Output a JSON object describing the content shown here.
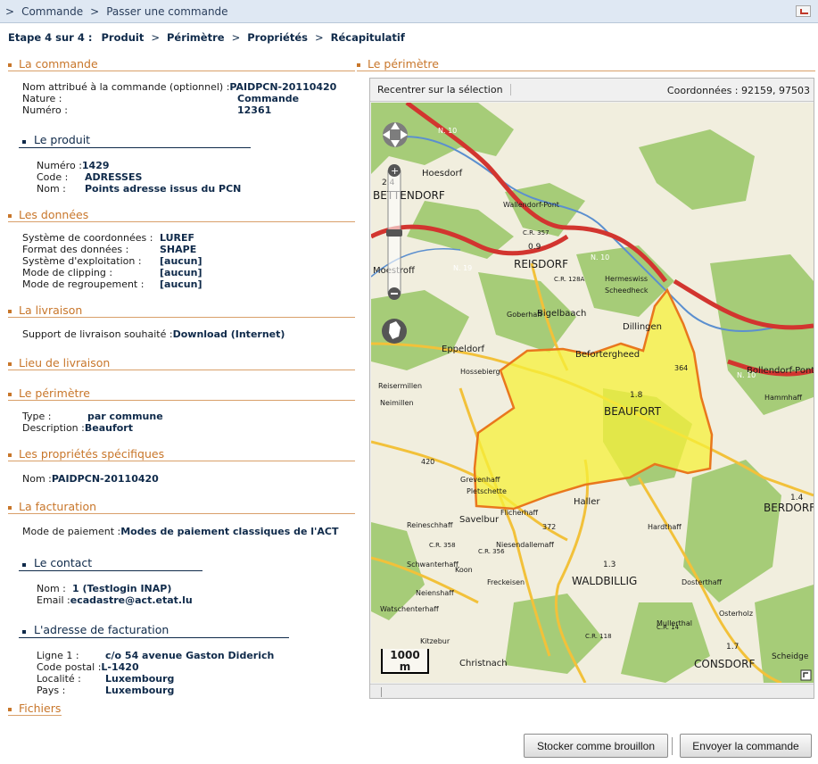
{
  "breadcrumb": {
    "items": [
      "Commande",
      "Passer une commande"
    ]
  },
  "steps": {
    "prefix": "Etape 4 sur 4 :",
    "items": [
      "Produit",
      "Périmètre",
      "Propriétés",
      "Récapitulatif"
    ]
  },
  "commande": {
    "title": "La commande",
    "rows": [
      {
        "label": "Nom attribué à la commande (optionnel) :",
        "value": "PAIDPCN-20110420"
      },
      {
        "label": "Nature :",
        "value": "Commande"
      },
      {
        "label": "Numéro :",
        "value": "12361"
      }
    ]
  },
  "produit": {
    "title": "Le produit",
    "rows": [
      {
        "label": "Numéro :",
        "value": "1429"
      },
      {
        "label": "Code :",
        "value": "ADRESSES"
      },
      {
        "label": "Nom :",
        "value": "Points adresse issus du PCN"
      }
    ]
  },
  "donnees": {
    "title": "Les données",
    "rows": [
      {
        "label": "Système de coordonnées :",
        "value": "LUREF"
      },
      {
        "label": "Format des données :",
        "value": "SHAPE"
      },
      {
        "label": "Système d'exploitation :",
        "value": "[aucun]"
      },
      {
        "label": "Mode de clipping :",
        "value": "[aucun]"
      },
      {
        "label": "Mode de regroupement :",
        "value": "[aucun]"
      }
    ]
  },
  "livraison": {
    "title": "La livraison",
    "rows": [
      {
        "label": "Support de livraison souhaité :",
        "value": "Download (Internet)"
      }
    ]
  },
  "lieu": {
    "title": "Lieu de livraison"
  },
  "perimetre": {
    "title": "Le périmètre",
    "rows": [
      {
        "label": "Type :",
        "value": "par commune"
      },
      {
        "label": "Description :",
        "value": "Beaufort"
      }
    ]
  },
  "proprietes": {
    "title": "Les propriétés spécifiques",
    "rows": [
      {
        "label": "Nom :",
        "value": "PAIDPCN-20110420"
      }
    ]
  },
  "facturation": {
    "title": "La facturation",
    "rows": [
      {
        "label": "Mode de paiement :",
        "value": "Modes de paiement classiques de l'ACT"
      }
    ]
  },
  "contact": {
    "title": "Le contact",
    "rows": [
      {
        "label": "Nom :",
        "value": "1 (Testlogin INAP)"
      },
      {
        "label": "Email :",
        "value": "ecadastre@act.etat.lu"
      }
    ]
  },
  "adresse": {
    "title": "L'adresse de facturation",
    "rows": [
      {
        "label": "Ligne 1 :",
        "value": "c/o 54 avenue Gaston Diderich"
      },
      {
        "label": "Code postal :",
        "value": "L-1420"
      },
      {
        "label": "Localité :",
        "value": "Luxembourg"
      },
      {
        "label": "Pays :",
        "value": "Luxembourg"
      }
    ]
  },
  "fichiers": {
    "title": "Fichiers"
  },
  "map": {
    "title": "Le périmètre",
    "recenter": "Recentrer sur la sélection",
    "coords": "Coordonnées : 92159, 97503",
    "scale": "1000 m",
    "places": [
      "BETTENDORF",
      "Hoesdorf",
      "Wallendorf-Pont",
      "REISDORF",
      "Moestroff",
      "Hermeswiss",
      "Scheedheck",
      "Bigelbaach",
      "Dillingen",
      "Eppeldorf",
      "Befortergheed",
      "Hossebierg",
      "Reisermillen",
      "Neimillen",
      "BEAUFORT",
      "Bollendorf-Pont",
      "Hammhaff",
      "Grevenhaff",
      "Pletschette",
      "Haller",
      "Savelbur",
      "BERDORF",
      "Flicherhaff",
      "Reineschhaff",
      "Niesendallemaff",
      "Koon",
      "Freckeisen",
      "WALDBILLIG",
      "Schwanterhaff",
      "Neienshaff",
      "Watschenterhaff",
      "Kitzebur",
      "Christnach",
      "CONSDORF",
      "Scheidge",
      "Mullerthal",
      "Dosterthaff",
      "Osterholz",
      "Hardthaff",
      "Goberhaff"
    ],
    "roads": [
      "N. 10",
      "N. 19",
      "N. 10",
      "N. 10",
      "C.R. 356",
      "C.R. 128A",
      "C.R. 358",
      "C.R. 357",
      "C.R. 14",
      "C.R. 118"
    ],
    "numbers": [
      "2.4",
      "0.9",
      "1.8",
      "1.3",
      "1.4",
      "1.7",
      "420",
      "372",
      "364"
    ],
    "colors": {
      "selection": "#f5f03a",
      "selection_border": "#e9771d",
      "forest": "#8fbf5f",
      "road_main": "#d2352f",
      "road_secondary": "#f2c13a",
      "river": "#5b8fcf"
    }
  },
  "buttons": {
    "save_draft": "Stocker comme brouillon",
    "send": "Envoyer la commande"
  }
}
